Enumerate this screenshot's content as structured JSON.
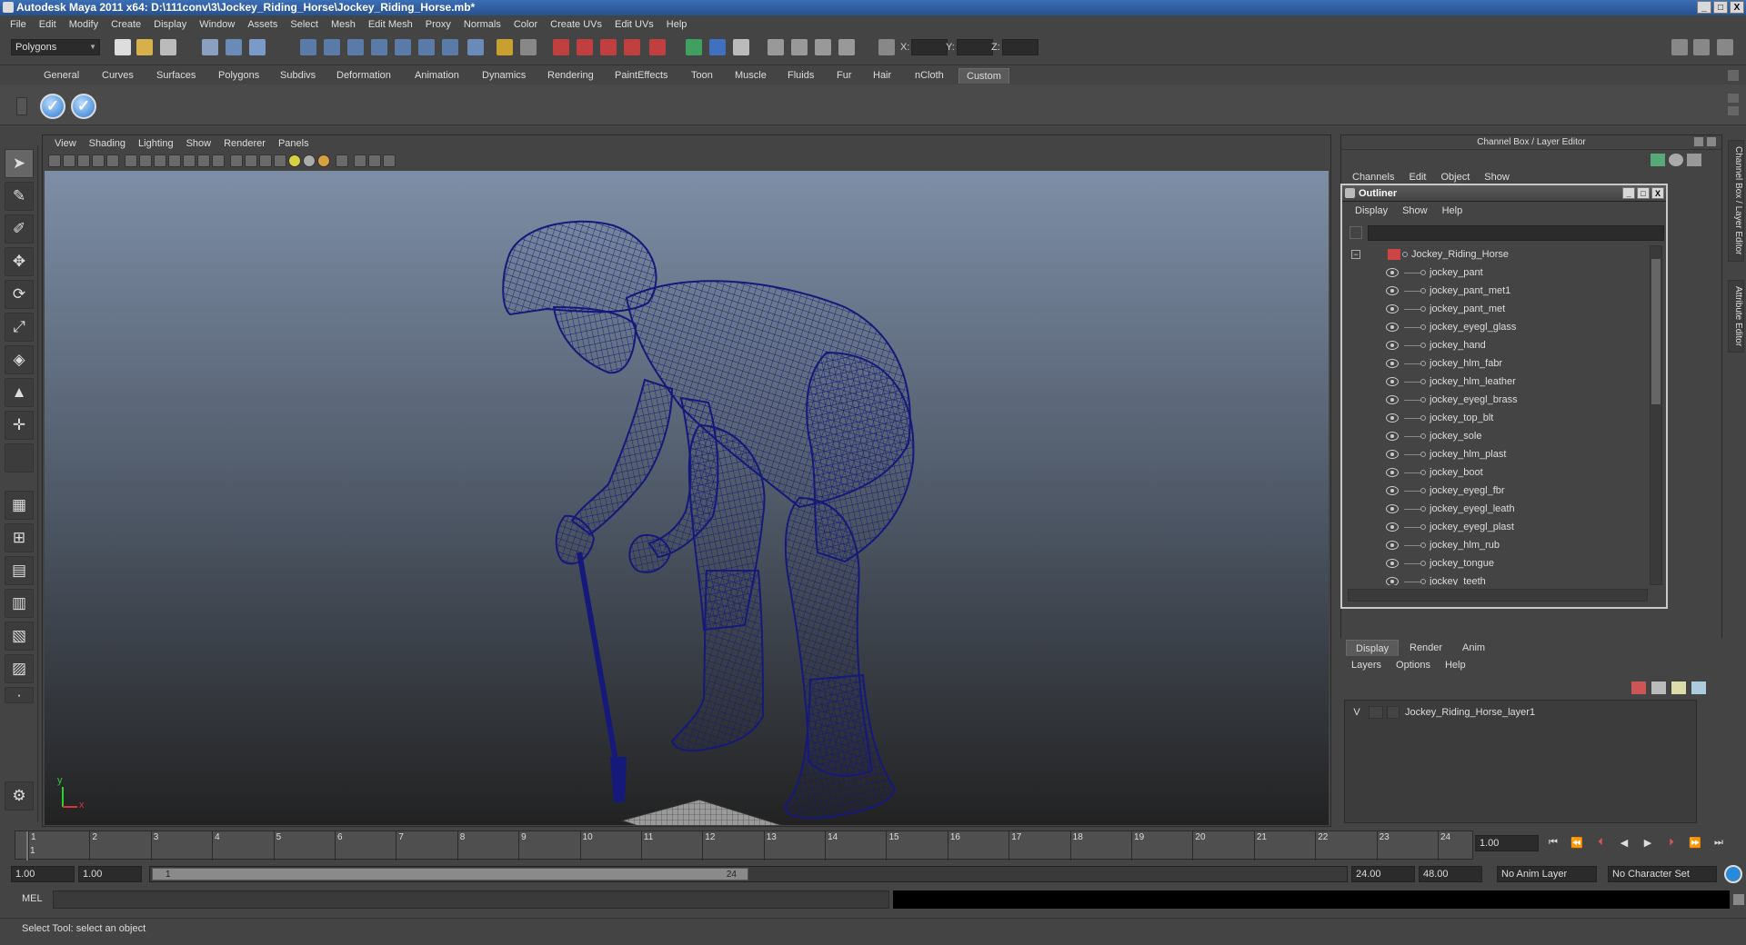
{
  "window": {
    "title": "Autodesk Maya 2011 x64: D:\\111conv\\3\\Jockey_Riding_Horse\\Jockey_Riding_Horse.mb*",
    "min": "_",
    "max": "□",
    "close": "X"
  },
  "menubar": [
    "File",
    "Edit",
    "Modify",
    "Create",
    "Display",
    "Window",
    "Assets",
    "Select",
    "Mesh",
    "Edit Mesh",
    "Proxy",
    "Normals",
    "Color",
    "Create UVs",
    "Edit UVs",
    "Help"
  ],
  "statusline": {
    "mode": "Polygons",
    "x_label": "X:",
    "y_label": "Y:",
    "z_label": "Z:"
  },
  "shelf_tabs": [
    "General",
    "Curves",
    "Surfaces",
    "Polygons",
    "Subdivs",
    "Deformation",
    "Animation",
    "Dynamics",
    "Rendering",
    "PaintEffects",
    "Toon",
    "Muscle",
    "Fluids",
    "Fur",
    "Hair",
    "nCloth",
    "Custom"
  ],
  "shelf_active": "Custom",
  "shelf_buttons": [
    "✓",
    "✓"
  ],
  "viewport": {
    "menu": [
      "View",
      "Shading",
      "Lighting",
      "Show",
      "Renderer",
      "Panels"
    ],
    "axis_x": "x",
    "axis_y": "y",
    "wire_color": "#15197a"
  },
  "channel_box": {
    "header": "Channel Box / Layer Editor",
    "menu": [
      "Channels",
      "Edit",
      "Object",
      "Show"
    ]
  },
  "side_tabs": [
    "Channel Box / Layer Editor",
    "Attribute Editor"
  ],
  "outliner": {
    "title": "Outliner",
    "menu": [
      "Display",
      "Show",
      "Help"
    ],
    "root": "Jockey_Riding_Horse",
    "items": [
      "jockey_pant",
      "jockey_pant_met1",
      "jockey_pant_met",
      "jockey_eyegl_glass",
      "jockey_hand",
      "jockey_hlm_fabr",
      "jockey_hlm_leather",
      "jockey_eyegl_brass",
      "jockey_top_blt",
      "jockey_sole",
      "jockey_hlm_plast",
      "jockey_boot",
      "jockey_eyegl_fbr",
      "jockey_eyegl_leath",
      "jockey_eyegl_plast",
      "jockey_hlm_rub",
      "jockey_tongue",
      "jockey_teeth"
    ]
  },
  "layer_editor": {
    "tabs": [
      "Display",
      "Render",
      "Anim"
    ],
    "active_tab": "Display",
    "menu": [
      "Layers",
      "Options",
      "Help"
    ],
    "layers": [
      {
        "visible": "V",
        "name": "Jockey_Riding_Horse_layer1"
      }
    ]
  },
  "time_slider": {
    "ticks": [
      "1",
      "2",
      "3",
      "4",
      "5",
      "6",
      "7",
      "8",
      "9",
      "10",
      "11",
      "12",
      "13",
      "14",
      "15",
      "16",
      "17",
      "18",
      "19",
      "20",
      "21",
      "22",
      "23",
      "24"
    ],
    "current_frame_label": "1",
    "current_time": "1.00",
    "playback": [
      "⏮",
      "⏪",
      "⏴",
      "◀",
      "▶",
      "⏵",
      "⏩",
      "⏭"
    ]
  },
  "range_slider": {
    "start": "1.00",
    "playback_start": "1.00",
    "range_start": "1",
    "range_end": "24",
    "playback_end": "24.00",
    "end": "48.00",
    "anim_layer": "No Anim Layer",
    "char_set": "No Character Set"
  },
  "command_line": {
    "label": "MEL"
  },
  "help_line": "Select Tool: select an object"
}
